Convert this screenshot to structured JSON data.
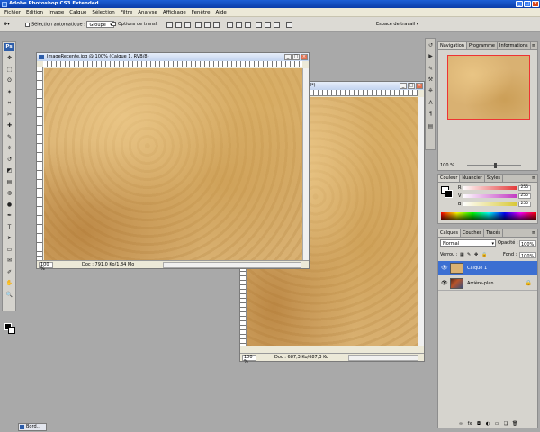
{
  "app": {
    "title": "Adobe Photoshop CS3 Extended",
    "ps_logo": "Ps",
    "window_buttons": [
      "_",
      "□",
      "×"
    ]
  },
  "menubar": {
    "items": [
      "Fichier",
      "Edition",
      "Image",
      "Calque",
      "Sélection",
      "Filtre",
      "Analyse",
      "Affichage",
      "Fenêtre",
      "Aide"
    ]
  },
  "options": {
    "auto_select_label": "Sélection automatique :",
    "auto_select_value": "Groupe",
    "transform_label": "Options de transf.",
    "workspace_label": "Espace de travail ▾"
  },
  "toolbox": {
    "tools": [
      "move-tool",
      "marquee-tool",
      "lasso-tool",
      "magic-wand-tool",
      "crop-tool",
      "slice-tool",
      "healing-brush-tool",
      "brush-tool",
      "clone-stamp-tool",
      "history-brush-tool",
      "eraser-tool",
      "gradient-tool",
      "blur-tool",
      "dodge-tool",
      "pen-tool",
      "type-tool",
      "path-selection-tool",
      "shape-tool",
      "notes-tool",
      "eyedropper-tool",
      "hand-tool",
      "zoom-tool"
    ],
    "glyphs": [
      "✥",
      "⬚",
      "ʘ",
      "✶",
      "⌗",
      "✂",
      "✚",
      "✎",
      "⎈",
      "↺",
      "◩",
      "▤",
      "◍",
      "●",
      "✒",
      "T",
      "➤",
      "▭",
      "✉",
      "✐",
      "✋",
      "🔍"
    ]
  },
  "doc_front": {
    "title": "ImageRecente.jpg @ 100% (Calque 1, RVB/8)",
    "zoom": "100 %",
    "info": "Doc : 791,0 Ko/1,84 Mo"
  },
  "doc_back": {
    "title": "8*)",
    "zoom": "100 %",
    "info": "Doc : 687,3 Ko/687,3 Ko"
  },
  "navigator": {
    "tabs": [
      "Navigation",
      "Programme",
      "Informations"
    ],
    "zoom": "100 %"
  },
  "color_panel": {
    "tabs": [
      "Couleur",
      "Nuancier",
      "Styles"
    ],
    "channels": [
      {
        "label": "R",
        "value": "255",
        "color": "#e43a3a"
      },
      {
        "label": "V",
        "value": "255",
        "color": "#c23bc2"
      },
      {
        "label": "B",
        "value": "255",
        "color": "#d8c838"
      }
    ]
  },
  "layers_panel": {
    "tabs": [
      "Calques",
      "Couches",
      "Tracés"
    ],
    "blend_mode": "Normal",
    "opacity_label": "Opacité :",
    "opacity_value": "100%",
    "lock_label": "Verrou :",
    "fill_label": "Fond :",
    "fill_value": "100%",
    "layers": [
      {
        "name": "Calque 1",
        "active": true
      },
      {
        "name": "Arrière-plan",
        "active": false
      }
    ]
  },
  "minimized_doc": {
    "title": "Bord..."
  }
}
